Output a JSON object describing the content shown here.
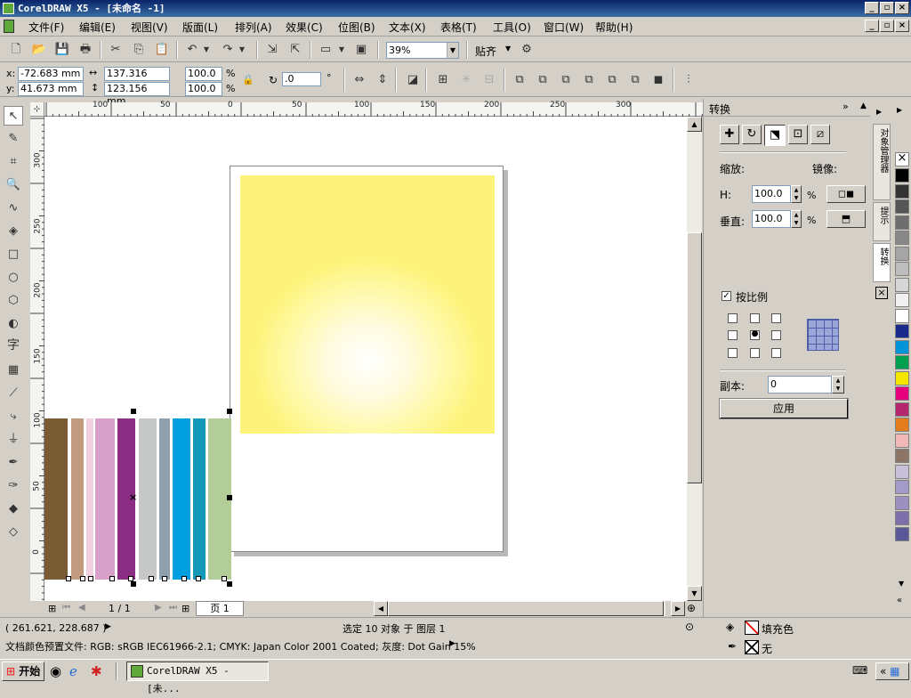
{
  "window": {
    "title": "CorelDRAW X5 - [未命名 -1]"
  },
  "menu": [
    "文件(F)",
    "编辑(E)",
    "视图(V)",
    "版面(L)",
    "排列(A)",
    "效果(C)",
    "位图(B)",
    "文本(X)",
    "表格(T)",
    "工具(O)",
    "窗口(W)",
    "帮助(H)"
  ],
  "toolbar": {
    "zoom": "39%",
    "snap_label": "贴齐"
  },
  "propbar": {
    "x": "-72.683 mm",
    "y": "41.673 mm",
    "width": "137.316 mm",
    "height": "123.156 mm",
    "scale_w": "100.0",
    "scale_h": "100.0",
    "percent": "%",
    "angle": ".0",
    "degree": "°"
  },
  "ruler_h": [
    "100",
    "50",
    "0",
    "50",
    "100",
    "150",
    "200",
    "250",
    "300"
  ],
  "ruler_v": [
    "300",
    "250",
    "200",
    "150",
    "100",
    "50",
    "0"
  ],
  "page_nav": {
    "page_count": "1 / 1",
    "page_tab": "页 1"
  },
  "panel": {
    "title": "转换",
    "scale_label": "缩放:",
    "mirror_label": "镜像:",
    "h_label": "H:",
    "h_value": "100.0",
    "v_label": "垂直:",
    "v_value": "100.0",
    "percent": "%",
    "proportional_label": "按比例",
    "copies_label": "副本:",
    "copies_value": "0",
    "apply_label": "应用",
    "side_tabs": [
      "对象管理器",
      "提示",
      "转换"
    ]
  },
  "palette": [
    "#000000",
    "#333333",
    "#555555",
    "#6e6e6e",
    "#888888",
    "#a5a5a5",
    "#bdbdbd",
    "#d6d6d6",
    "#f0f0f0",
    "#ffffff",
    "#1a2a8c",
    "#0094d8",
    "#00a050",
    "#f5e600",
    "#e6007e",
    "#b4276e",
    "#e47d1e",
    "#f2b8b8",
    "#8c7466",
    "#c8c0d8",
    "#a39cc8",
    "#9b90c0",
    "#7b70ab",
    "#5a5896"
  ],
  "bars": [
    {
      "color": "#7a5c34",
      "width": 26
    },
    {
      "color": "#c19a80",
      "width": 14
    },
    {
      "color": "#f0d0e0",
      "width": 8
    },
    {
      "color": "#d6a0c8",
      "width": 22
    },
    {
      "color": "#8b2d82",
      "width": 20
    },
    {
      "color": "#c6c8c8",
      "width": 20
    },
    {
      "color": "#8ea0ae",
      "width": 12
    },
    {
      "color": "#00a0e0",
      "width": 20
    },
    {
      "color": "#1498b8",
      "width": 14
    },
    {
      "color": "#b2cd98",
      "width": 26
    }
  ],
  "status": {
    "coords": "( 261.621, 228.687 )",
    "selection": "选定 10 对象 于 图层 1",
    "fill_label": "填充色",
    "outline_label": "无",
    "color_profile": "文档颜色预置文件: RGB: sRGB IEC61966-2.1; CMYK: Japan Color 2001 Coated; 灰度: Dot Gain 15%"
  },
  "taskbar": {
    "start": "开始",
    "task": "CorelDRAW X5 - [未..."
  }
}
